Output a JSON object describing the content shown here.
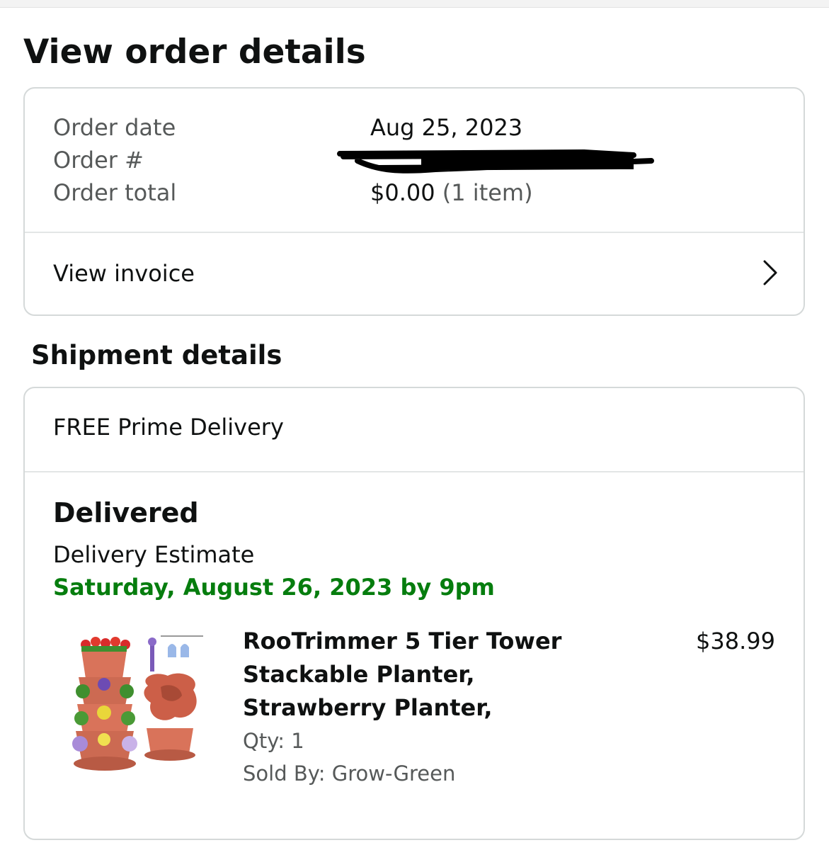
{
  "page": {
    "title": "View order details"
  },
  "order_summary": {
    "date_label": "Order date",
    "date_value": "Aug 25, 2023",
    "number_label": "Order #",
    "number_value": "",
    "total_label": "Order total",
    "total_value": "$0.00",
    "item_count": "(1 item)",
    "invoice_label": "View invoice"
  },
  "shipment": {
    "section_title": "Shipment details",
    "delivery_type": "FREE Prime Delivery",
    "status": "Delivered",
    "estimate_label": "Delivery Estimate",
    "estimate_date": "Saturday, August 26, 2023 by 9pm",
    "estimate_color": "#067d0e"
  },
  "item": {
    "title": "RooTrimmer 5 Tier Tower Stackable Planter, Strawberry Planter,",
    "price": "$38.99",
    "qty": "Qty: 1",
    "sold_by": "Sold By: Grow-Green"
  }
}
